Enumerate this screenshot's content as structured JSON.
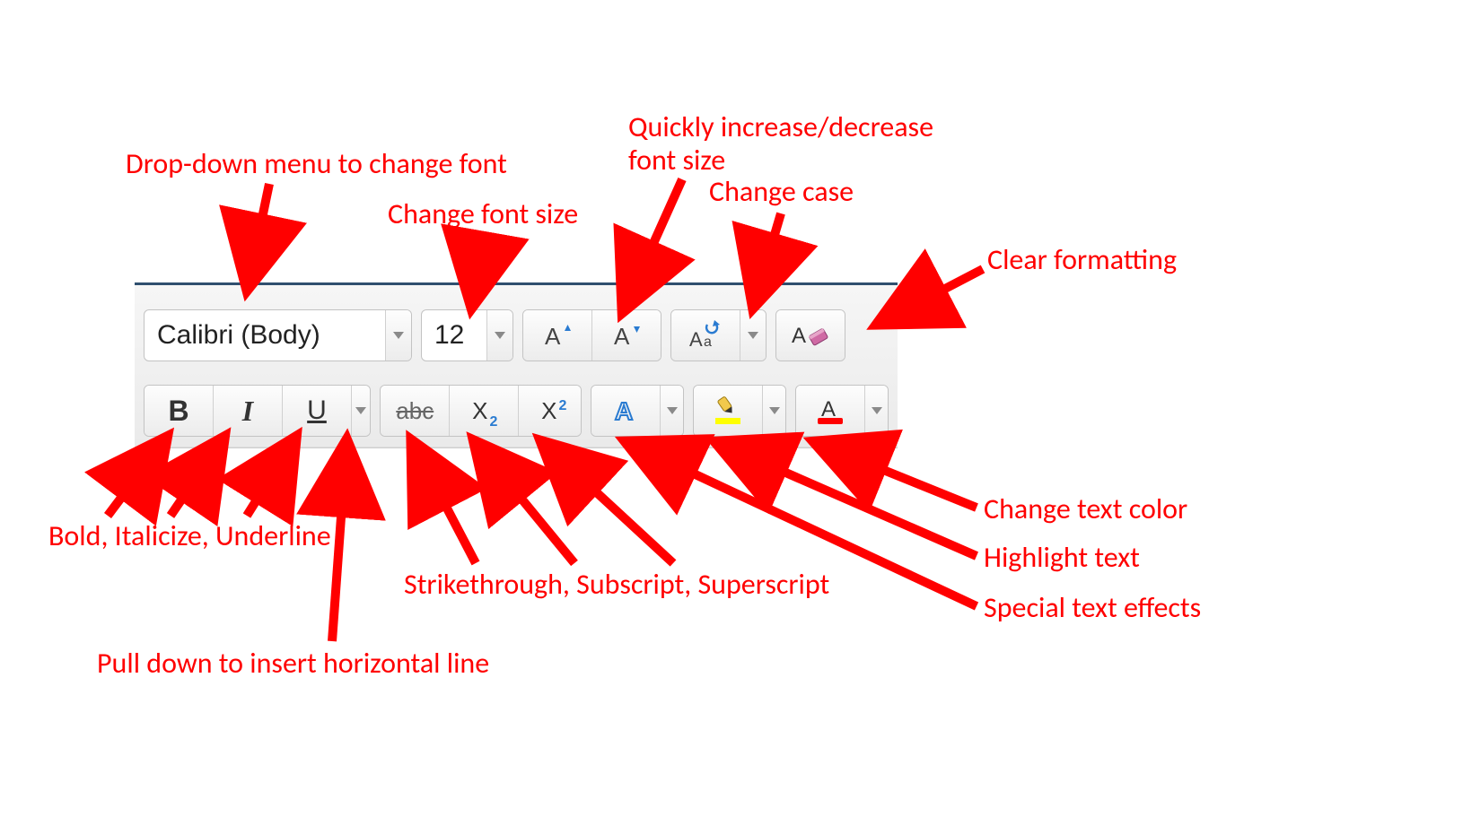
{
  "toolbar": {
    "font_name": "Calibri (Body)",
    "font_size": "12",
    "buttons": {
      "bold": "B",
      "italic": "I",
      "underline": "U",
      "strike": "abc",
      "subscript_x": "X",
      "subscript_n": "2",
      "superscript_x": "X",
      "superscript_n": "2"
    }
  },
  "annotations": {
    "font_dropdown": "Drop-down menu to change font",
    "font_size": "Change font size",
    "grow_shrink": "Quickly increase/decrease\nfont size",
    "change_case": "Change case",
    "clear_fmt": "Clear formatting",
    "biu": "Bold, Italicize, Underline",
    "hline": "Pull down to insert horizontal line",
    "sss": "Strikethrough, Subscript, Superscript",
    "text_effects": "Special text effects",
    "highlight": "Highlight text",
    "text_color": "Change text color"
  }
}
